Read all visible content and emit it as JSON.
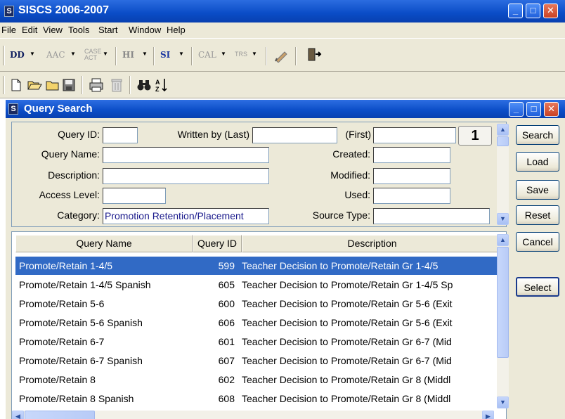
{
  "app": {
    "title": "SISCS 2006-2007",
    "icon_glyph": "S",
    "caption_buttons": {
      "minimize": "_",
      "maximize": "□",
      "close": "✕"
    }
  },
  "menu": [
    "File",
    "Edit",
    "View",
    "Tools",
    "Start",
    "Window",
    "Help"
  ],
  "toolbar1": {
    "items": [
      {
        "label": "DD",
        "has_dropdown": true,
        "style": "bold"
      },
      {
        "label": "AAC",
        "has_dropdown": true,
        "style": "gray"
      },
      {
        "label": "CASE ACT",
        "has_dropdown": true,
        "style": "tiny"
      },
      {
        "label": "HI",
        "has_dropdown": true,
        "style": "gray-bold"
      },
      {
        "label": "SI",
        "has_dropdown": true,
        "style": "blue-bold"
      },
      {
        "label": "CAL",
        "has_dropdown": true,
        "style": "gray"
      },
      {
        "label": "TRS",
        "has_dropdown": true,
        "style": "tiny"
      }
    ],
    "dropdown_glyph": "▼",
    "pen_icon": "pen-icon",
    "exit_icon": "exit-door-icon"
  },
  "toolbar2": {
    "icons": [
      "new-document-icon",
      "open-folder-icon",
      "folder-icon",
      "save-disk-icon",
      "print-icon",
      "delete-trash-icon",
      "find-binoculars-icon",
      "sort-az-icon"
    ]
  },
  "child": {
    "title": "Query Search",
    "icon_glyph": "S"
  },
  "form": {
    "labels": {
      "query_id": "Query ID:",
      "written_by": "Written by (Last)",
      "first": "(First)",
      "query_name": "Query Name:",
      "created": "Created:",
      "description": "Description:",
      "modified": "Modified:",
      "access_level": "Access Level:",
      "used": "Used:",
      "category": "Category:",
      "source_type": "Source Type:"
    },
    "values": {
      "query_id": "",
      "written_by_last": "",
      "first": "",
      "query_name": "",
      "created": "",
      "description": "",
      "modified": "",
      "access_level": "",
      "used": "",
      "category": "Promotion Retention/Placement",
      "source_type": ""
    },
    "page_number": "1"
  },
  "buttons": {
    "search": "Search",
    "load": "Load",
    "save": "Save",
    "reset": "Reset",
    "cancel": "Cancel",
    "select": "Select"
  },
  "grid": {
    "columns": [
      "Query Name",
      "Query ID",
      "Description"
    ],
    "rows": [
      {
        "name": "Promote/Retain  1-4/5",
        "id": "599",
        "description": "Teacher Decision to Promote/Retain Gr 1-4/5",
        "selected": true
      },
      {
        "name": "Promote/Retain  1-4/5 Spanish",
        "id": "605",
        "description": "Teacher Decision to Promote/Retain Gr 1-4/5 Sp",
        "selected": false
      },
      {
        "name": "Promote/Retain 5-6",
        "id": "600",
        "description": "Teacher Decision to Promote/Retain Gr 5-6 (Exit",
        "selected": false
      },
      {
        "name": "Promote/Retain 5-6 Spanish",
        "id": "606",
        "description": "Teacher Decision to Promote/Retain Gr 5-6 (Exit",
        "selected": false
      },
      {
        "name": "Promote/Retain 6-7",
        "id": "601",
        "description": "Teacher Decision to Promote/Retain Gr 6-7 (Mid",
        "selected": false
      },
      {
        "name": "Promote/Retain 6-7 Spanish",
        "id": "607",
        "description": "Teacher Decision to Promote/Retain Gr 6-7 (Mid",
        "selected": false
      },
      {
        "name": "Promote/Retain 8",
        "id": "602",
        "description": "Teacher Decision to Promote/Retain Gr 8 (Middl",
        "selected": false
      },
      {
        "name": "Promote/Retain 8 Spanish",
        "id": "608",
        "description": "Teacher Decision to Promote/Retain Gr 8 (Middl",
        "selected": false
      }
    ]
  },
  "colors": {
    "titlebar": "#0a4cc6",
    "selection": "#316ac5",
    "chrome": "#ece9d8",
    "field_text": "#1a1a8c"
  }
}
